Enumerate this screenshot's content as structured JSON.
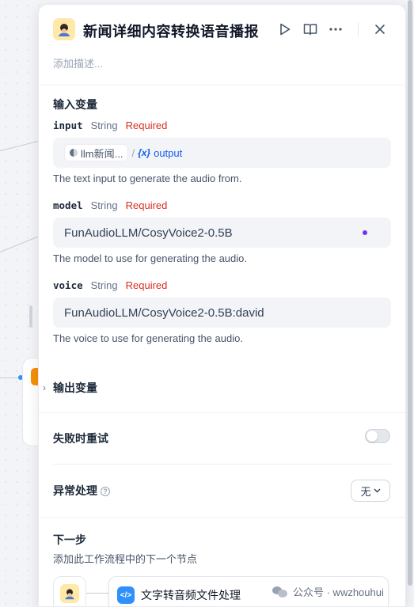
{
  "header": {
    "title": "新闻详细内容转换语音播报",
    "description_placeholder": "添加描述..."
  },
  "input_section": {
    "label": "输入变量",
    "variables": [
      {
        "name": "input",
        "type": "String",
        "required": "Required",
        "source_node": "llm新闻...",
        "separator": "/",
        "var_symbol": "{x}",
        "var_name": "output",
        "hint": "The text input to generate the audio from."
      },
      {
        "name": "model",
        "type": "String",
        "required": "Required",
        "value": "FunAudioLLM/CosyVoice2-0.5B",
        "hint": "The model to use for generating the audio."
      },
      {
        "name": "voice",
        "type": "String",
        "required": "Required",
        "value": "FunAudioLLM/CosyVoice2-0.5B:david",
        "hint": "The voice to use for generating the audio."
      }
    ]
  },
  "output_section": {
    "label": "输出变量"
  },
  "retry": {
    "label": "失败时重试",
    "enabled": false
  },
  "exception": {
    "label": "异常处理",
    "selected": "无"
  },
  "next_step": {
    "label": "下一步",
    "description": "添加此工作流程中的下一个节点",
    "next_node": "文字转音频文件处理"
  },
  "watermark": {
    "text": "公众号 · wwzhouhui"
  },
  "colors": {
    "accent": "#155eef",
    "required": "#d92d20",
    "node_icon_bg": "#ffe9a8",
    "code_icon_bg": "#2e90fa"
  }
}
